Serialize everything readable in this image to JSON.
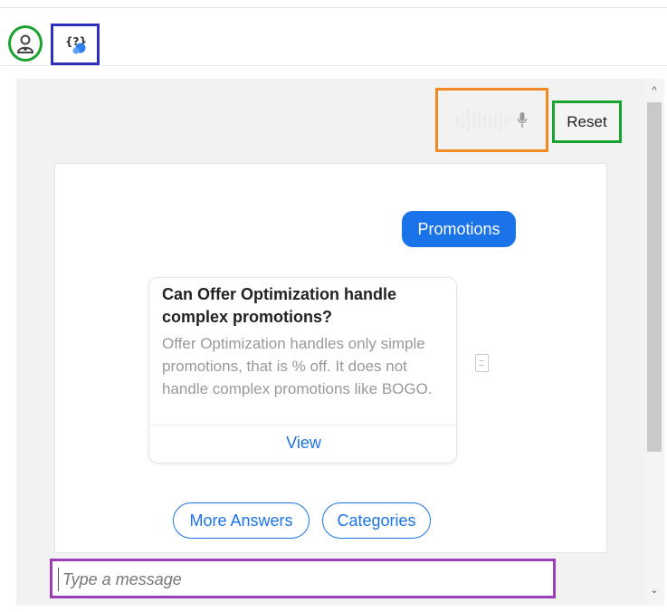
{
  "toolbar": {
    "assistant_icon": "assistant-avatar-icon",
    "help_icon": "help-question-icon"
  },
  "controls": {
    "voice_icon": "microphone-icon",
    "reset_label": "Reset"
  },
  "conversation": {
    "user_message": "Promotions",
    "answer": {
      "title": "Can Offer Optimization handle complex promotions?",
      "body": "Offer Optimization handles only simple promotions, that is % off. It does not handle complex promotions like BOGO.",
      "view_label": "View"
    },
    "actions": {
      "more_answers": "More Answers",
      "categories": "Categories"
    }
  },
  "composer": {
    "placeholder": "Type a message"
  },
  "colors": {
    "accent": "#1a73e8",
    "highlight_green": "#1aa32f",
    "highlight_blue": "#2f2fbe",
    "highlight_orange": "#f08a24",
    "highlight_purple": "#9a3fb5"
  }
}
